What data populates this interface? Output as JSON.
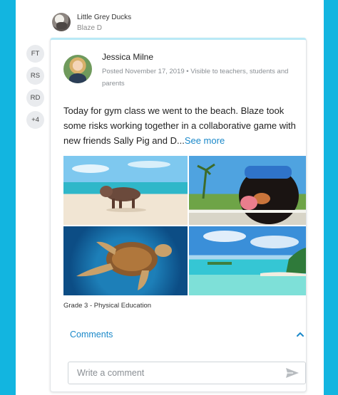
{
  "class_header": {
    "class_name": "Little Grey Ducks",
    "student_name": "Blaze D"
  },
  "recipients": [
    "FT",
    "RS",
    "RD",
    "+4"
  ],
  "post": {
    "author": "Jessica Milne",
    "meta": "Posted November 17, 2019 • Visible to teachers, students and parents",
    "body": "Today for gym class we went to the beach. Blaze took some risks working together in a collaborative game with new friends Sally Pig and D...",
    "see_more": "See more",
    "tag": "Grade 3 - Physical Education"
  },
  "comments": {
    "label": "Comments",
    "placeholder": "Write a comment"
  },
  "icons": {
    "more": "more-vertical-icon",
    "chevron": "chevron-up-icon",
    "send": "send-icon"
  },
  "colors": {
    "background": "#12b5e0",
    "link": "#1a88c9",
    "card_accent": "#b9e9f6"
  }
}
